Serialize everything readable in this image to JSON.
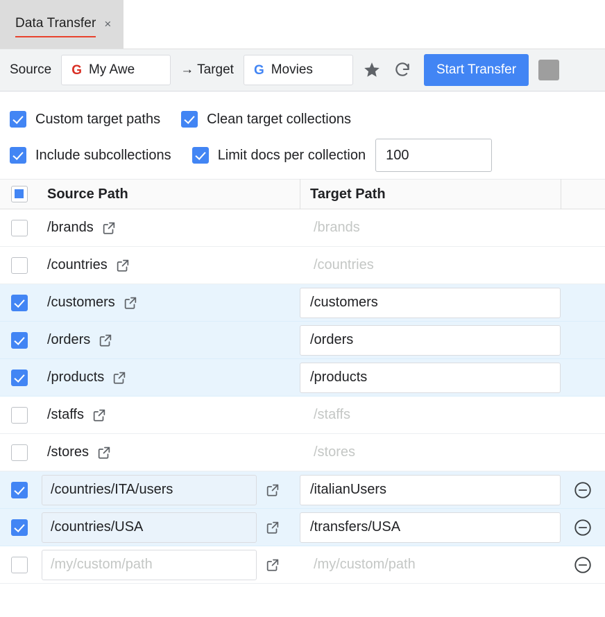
{
  "tab": {
    "title": "Data Transfer",
    "close_label": "×"
  },
  "toolbar": {
    "source_label": "Source",
    "source_project": "My Awe",
    "source_icon": "google-g-icon",
    "arrow_target_label": "→ Target",
    "target_project": "Movies",
    "target_icon": "google-g-icon",
    "favorite_icon": "star-icon",
    "refresh_icon": "refresh-icon",
    "start_label": "Start Transfer",
    "avatar_placeholder": "image-placeholder"
  },
  "options": {
    "custom_target_paths": {
      "label": "Custom target paths",
      "checked": true
    },
    "clean_target_collections": {
      "label": "Clean target collections",
      "checked": true
    },
    "include_subcollections": {
      "label": "Include subcollections",
      "checked": true
    },
    "limit_docs_per_collection": {
      "label": "Limit docs per collection",
      "checked": true
    },
    "limit_value": "100"
  },
  "table": {
    "select_all_state": "indeterminate",
    "columns": [
      "Source Path",
      "Target Path"
    ],
    "rows": [
      {
        "source": "/brands",
        "target": "/brands",
        "checked": false,
        "custom": false
      },
      {
        "source": "/countries",
        "target": "/countries",
        "checked": false,
        "custom": false
      },
      {
        "source": "/customers",
        "target": "/customers",
        "checked": true,
        "custom": false
      },
      {
        "source": "/orders",
        "target": "/orders",
        "checked": true,
        "custom": false
      },
      {
        "source": "/products",
        "target": "/products",
        "checked": true,
        "custom": false
      },
      {
        "source": "/staffs",
        "target": "/staffs",
        "checked": false,
        "custom": false
      },
      {
        "source": "/stores",
        "target": "/stores",
        "checked": false,
        "custom": false
      }
    ],
    "custom_rows": [
      {
        "source": "/countries/ITA/users",
        "target": "/italianUsers",
        "checked": true,
        "empty": false
      },
      {
        "source": "/countries/USA",
        "target": "/transfers/USA",
        "checked": true,
        "empty": false
      },
      {
        "source": "",
        "target": "",
        "checked": false,
        "empty": true
      }
    ],
    "custom_placeholder": "/my/custom/path",
    "remove_icon": "minus-circle-icon",
    "open_icon": "external-link-icon"
  },
  "colors": {
    "accent": "#4285f4",
    "selected_row": "#e8f4fd",
    "tab_underline": "#e8422e",
    "source_g": "#d93025",
    "target_g": "#4285f4"
  }
}
